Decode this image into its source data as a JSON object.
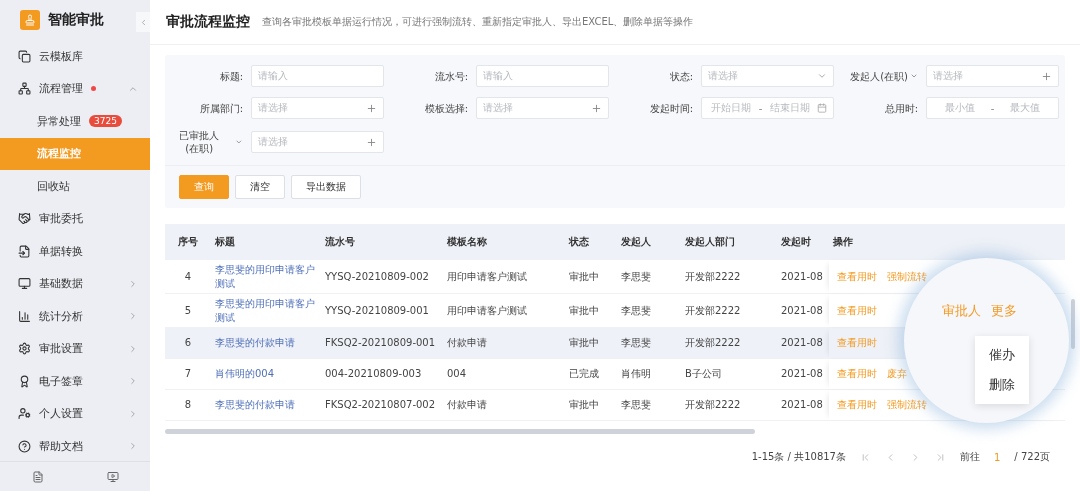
{
  "app": {
    "name": "智能审批"
  },
  "sidebar": {
    "items": [
      {
        "label": "云模板库",
        "selected": false,
        "dot": false
      },
      {
        "label": "流程管理",
        "selected": false,
        "dot": true,
        "expanded": true,
        "children": [
          {
            "label": "异常处理",
            "selected": false,
            "badge": "3725"
          },
          {
            "label": "流程监控",
            "selected": true
          },
          {
            "label": "回收站",
            "selected": false
          }
        ]
      },
      {
        "label": "审批委托",
        "selected": false,
        "dot": false
      },
      {
        "label": "单据转换",
        "selected": false,
        "dot": false
      },
      {
        "label": "基础数据",
        "selected": false,
        "dot": false,
        "expanded": false
      },
      {
        "label": "统计分析",
        "selected": false,
        "dot": false,
        "expanded": false
      },
      {
        "label": "审批设置",
        "selected": false,
        "dot": false,
        "expanded": false
      },
      {
        "label": "电子签章",
        "selected": false,
        "dot": false,
        "expanded": false
      },
      {
        "label": "个人设置",
        "selected": false,
        "dot": false,
        "expanded": false
      },
      {
        "label": "帮助文档",
        "selected": false,
        "dot": false,
        "expanded": false
      }
    ]
  },
  "page": {
    "title": "审批流程监控",
    "description": "查询各审批模板单据运行情况，可进行强制流转、重新指定审批人、导出EXCEL、删除单据等操作"
  },
  "filters": [
    {
      "kind": "input",
      "label": "标题:",
      "label_caret": false,
      "placeholder": "请输入"
    },
    {
      "kind": "input",
      "label": "流水号:",
      "label_caret": false,
      "placeholder": "请输入"
    },
    {
      "kind": "select",
      "label": "状态:",
      "label_caret": false,
      "placeholder": "请选择"
    },
    {
      "kind": "picker",
      "label": "发起人(在职)",
      "label_caret": true,
      "placeholder": "请选择"
    },
    {
      "kind": "picker",
      "label": "所属部门:",
      "label_caret": false,
      "placeholder": "请选择"
    },
    {
      "kind": "picker",
      "label": "模板选择:",
      "label_caret": false,
      "placeholder": "请选择"
    },
    {
      "kind": "daterange",
      "label": "发起时间:",
      "label_caret": false,
      "placeholder": "开始日期",
      "placeholder_end": "结束日期",
      "separator": "-"
    },
    {
      "kind": "range",
      "label": "总用时:",
      "label_caret": false,
      "placeholder": "最小值",
      "placeholder_end": "最大值",
      "separator": "-"
    },
    {
      "kind": "picker",
      "label": "已审批人 (在职)",
      "label_caret": true,
      "placeholder": "请选择"
    }
  ],
  "buttons": [
    {
      "label": "查询",
      "kind": "primary"
    },
    {
      "label": "清空",
      "kind": "plain"
    },
    {
      "label": "导出数据",
      "kind": "plain"
    }
  ],
  "table": {
    "columns": [
      "序号",
      "标题",
      "流水号",
      "模板名称",
      "状态",
      "发起人",
      "发起人部门",
      "发起时",
      "操作"
    ],
    "rows": [
      {
        "index": "4",
        "title": "李思斐的用印申请客户测试",
        "serial": "YYSQ-20210809-002",
        "template": "用印申请客户测试",
        "status": "审批中",
        "initiator": "李思斐",
        "dept": "开发部2222",
        "time": "2021-08",
        "actions": [
          "查看用时",
          "强制流转"
        ],
        "selected": false
      },
      {
        "index": "5",
        "title": "李思斐的用印申请客户测试",
        "serial": "YYSQ-20210809-001",
        "template": "用印申请客户测试",
        "status": "审批中",
        "initiator": "李思斐",
        "dept": "开发部2222",
        "time": "2021-08",
        "actions": [
          "查看用时"
        ],
        "selected": false
      },
      {
        "index": "6",
        "title": "李思斐的付款申请",
        "serial": "FKSQ2-20210809-001",
        "template": "付款申请",
        "status": "审批中",
        "initiator": "李思斐",
        "dept": "开发部2222",
        "time": "2021-08",
        "actions": [
          "查看用时"
        ],
        "selected": true
      },
      {
        "index": "7",
        "title": "肖伟明的004",
        "serial": "004-20210809-003",
        "template": "004",
        "status": "已完成",
        "initiator": "肖伟明",
        "dept": "B子公司",
        "time": "2021-08",
        "actions": [
          "查看用时",
          "废弃"
        ],
        "selected": false
      },
      {
        "index": "8",
        "title": "李思斐的付款申请",
        "serial": "FKSQ2-20210807-002",
        "template": "付款申请",
        "status": "审批中",
        "initiator": "李思斐",
        "dept": "开发部2222",
        "time": "2021-08",
        "actions": [
          "查看用时",
          "强制流转"
        ],
        "selected": false
      }
    ]
  },
  "magnifier": {
    "links": [
      "审批人",
      "更多"
    ],
    "menu": [
      "催办",
      "删除"
    ]
  },
  "pagination": {
    "summary": "1-15条 / 共10817条",
    "goto": "前往",
    "page": "1",
    "total": "/ 722页"
  }
}
